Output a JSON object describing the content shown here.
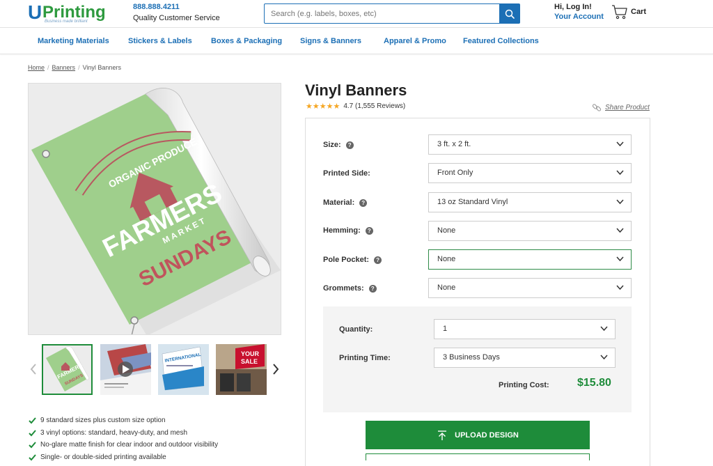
{
  "header": {
    "logo_u": "U",
    "logo_rest": "Printing",
    "logo_tagline": "Business made brilliant",
    "phone": "888.888.4211",
    "service": "Quality Customer Service",
    "search_placeholder": "Search (e.g. labels, boxes, etc)",
    "login": "Hi, Log In!",
    "account": "Your Account",
    "cart": "Cart"
  },
  "nav": [
    "Marketing Materials",
    "Stickers & Labels",
    "Boxes & Packaging",
    "Signs & Banners",
    "Apparel & Promo",
    "Featured Collections"
  ],
  "breadcrumb": [
    "Home",
    "Banners",
    "Vinyl Banners"
  ],
  "hero_image": {
    "ribbon_text": "ORGANIC PRODUCE",
    "line1": "FARMERS",
    "line2": "MARKET",
    "line3": "SUNDAYS"
  },
  "thumbnails": {
    "thumb2_caption": "Play video",
    "thumb3_text": "INTERNATIONAL",
    "thumb4_text_1": "YOUR",
    "thumb4_text_2": "SALE"
  },
  "features": [
    "9 standard sizes plus custom size option",
    "3 vinyl options: standard, heavy-duty, and mesh",
    "No-glare matte finish for clear indoor and outdoor visibility",
    "Single- or double-sided printing available"
  ],
  "product": {
    "title": "Vinyl Banners",
    "rating_value": "4.7",
    "reviews": "(1,555 Reviews)",
    "share": "Share Product"
  },
  "options": [
    {
      "label": "Size:",
      "help": true,
      "value": "3 ft. x 2 ft."
    },
    {
      "label": "Printed Side:",
      "help": false,
      "value": "Front Only"
    },
    {
      "label": "Material:",
      "help": true,
      "value": "13 oz Standard Vinyl"
    },
    {
      "label": "Hemming:",
      "help": true,
      "value": "None"
    },
    {
      "label": "Pole Pocket:",
      "help": true,
      "value": "None"
    },
    {
      "label": "Grommets:",
      "help": true,
      "value": "None"
    }
  ],
  "order": {
    "quantity_label": "Quantity:",
    "quantity_value": "1",
    "time_label": "Printing Time:",
    "time_value": "3 Business Days",
    "cost_label": "Printing Cost:",
    "cost_value": "$15.80"
  },
  "upload_label": "UPLOAD DESIGN",
  "colors": {
    "brand_blue": "#1c6fb5",
    "brand_green": "#1e8c3a",
    "star": "#f5a623"
  }
}
